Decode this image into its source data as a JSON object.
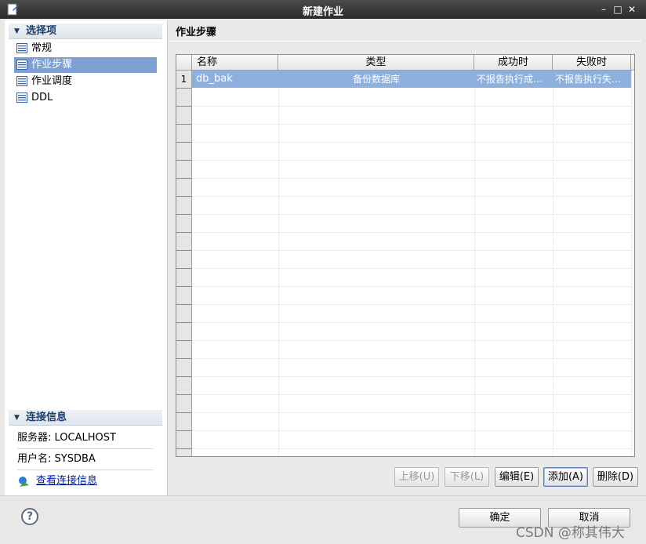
{
  "window": {
    "title": "新建作业",
    "minimize": "–",
    "maximize": "□",
    "close": "✕"
  },
  "sidebar": {
    "options_header": "选择项",
    "items": [
      {
        "label": "常规",
        "selected": false
      },
      {
        "label": "作业步骤",
        "selected": true
      },
      {
        "label": "作业调度",
        "selected": false
      },
      {
        "label": "DDL",
        "selected": false
      }
    ],
    "connection_header": "连接信息",
    "server": "服务器:  LOCALHOST",
    "user": "用户名:  SYSDBA",
    "view_connection": "查看连接信息"
  },
  "main": {
    "title": "作业步骤",
    "table": {
      "columns": [
        "名称",
        "类型",
        "成功时",
        "失败时"
      ],
      "rows": [
        {
          "num": "1",
          "name": "db_bak",
          "type": "备份数据库",
          "on_success": "不报告执行成...",
          "on_failure": "不报告执行失..."
        }
      ]
    },
    "buttons": {
      "move_up": "上移(U)",
      "move_down": "下移(L)",
      "edit": "编辑(E)",
      "add": "添加(A)",
      "delete": "删除(D)"
    }
  },
  "footer": {
    "help": "?",
    "ok": "确定",
    "cancel": "取消"
  },
  "watermark": "CSDN @称其伟大"
}
